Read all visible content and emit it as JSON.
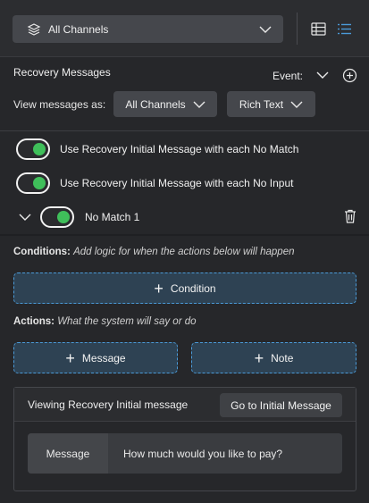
{
  "toolbar": {
    "channel_label": "All Channels",
    "icons": [
      "layers-icon",
      "chevron-down-icon",
      "table-view-icon",
      "list-view-icon"
    ]
  },
  "recovery": {
    "title": "Recovery Messages",
    "event_label": "Event:",
    "view_as_label": "View messages as:",
    "channel_filter": "All Channels",
    "format_filter": "Rich Text"
  },
  "toggles": [
    {
      "label": "Use Recovery Initial Message with each No Match",
      "on": true
    },
    {
      "label": "Use Recovery Initial Message with each No Input",
      "on": true
    },
    {
      "label": "No Match 1",
      "on": true
    }
  ],
  "conditions": {
    "title": "Conditions:",
    "hint": "Add logic for when the actions below will happen",
    "button": "Condition"
  },
  "actions": {
    "title": "Actions:",
    "hint": "What the system will say or do",
    "message_button": "Message",
    "note_button": "Note"
  },
  "viewer": {
    "heading": "Viewing Recovery Initial message",
    "goto_button": "Go to Initial Message",
    "row_key": "Message",
    "row_value": "How much would you like to pay?"
  },
  "colors": {
    "accent": "#4a9ad8",
    "toggle_on": "#3fbf5a",
    "background": "#26272a"
  }
}
